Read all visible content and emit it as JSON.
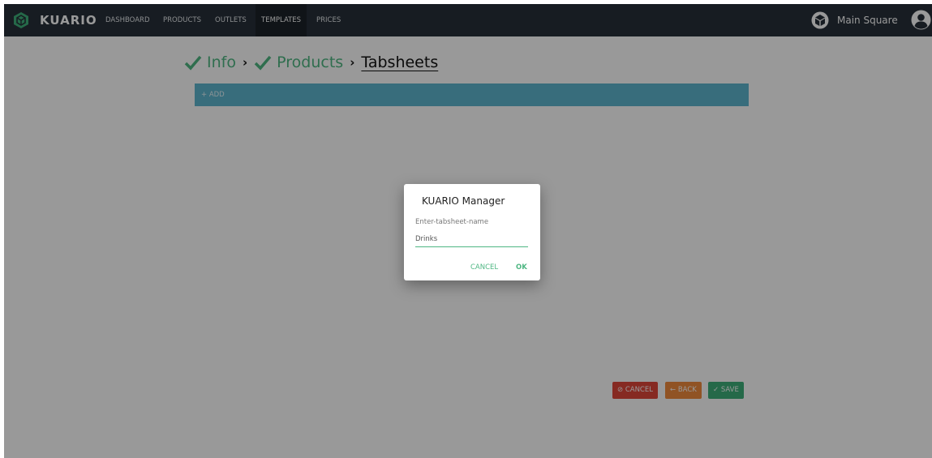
{
  "navbar": {
    "brand": "KUARIO",
    "items": [
      {
        "label": "DASHBOARD"
      },
      {
        "label": "PRODUCTS"
      },
      {
        "label": "OUTLETS"
      },
      {
        "label": "TEMPLATES",
        "active": true
      },
      {
        "label": "PRICES"
      }
    ],
    "outlet_name": "Main Square"
  },
  "steps": [
    {
      "label": "Info",
      "done": true
    },
    {
      "label": "Products",
      "done": true
    },
    {
      "label": "Tabsheets",
      "current": true
    }
  ],
  "add_bar": {
    "label": "+ ADD"
  },
  "actions": {
    "cancel": "⊘ CANCEL",
    "back": "← BACK",
    "save": "✓ SAVE"
  },
  "dialog": {
    "title": "KUARIO Manager",
    "label": "Enter-tabsheet-name",
    "input_value": "Drinks",
    "cancel": "CANCEL",
    "ok": "OK"
  },
  "colors": {
    "navbar": "#27303a",
    "accent": "#4fb783",
    "add_bar": "#5eb6cf",
    "cancel": "#e0463a",
    "back": "#f08a3d",
    "save": "#3fb07a"
  }
}
